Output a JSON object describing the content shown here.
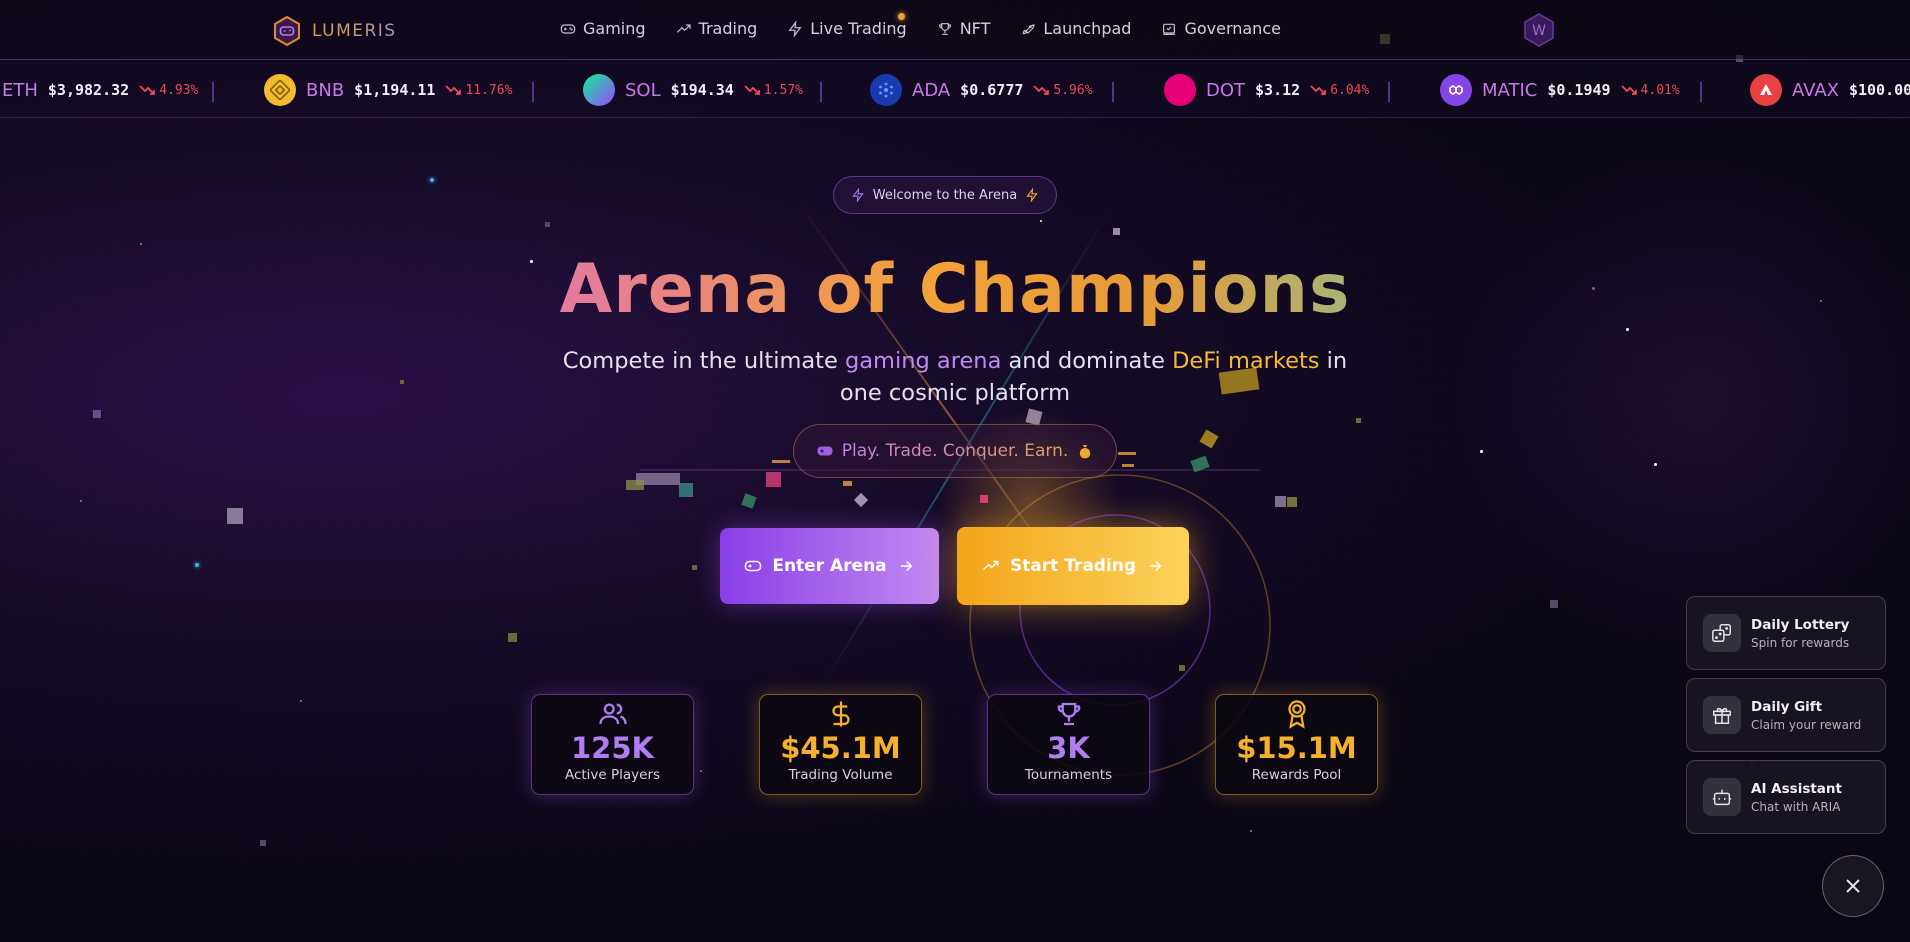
{
  "brand": {
    "name": "LUMERIS"
  },
  "nav": [
    {
      "label": "Gaming",
      "icon": "gamepad-icon"
    },
    {
      "label": "Trading",
      "icon": "trending-up-icon"
    },
    {
      "label": "Live Trading",
      "icon": "zap-icon"
    },
    {
      "label": "NFT",
      "icon": "trophy-icon"
    },
    {
      "label": "Launchpad",
      "icon": "rocket-icon"
    },
    {
      "label": "Governance",
      "icon": "vote-icon"
    }
  ],
  "wallet": {
    "label": "W"
  },
  "ticker": [
    {
      "symbol": "ETH",
      "price": "$3,982.32",
      "change": "4.93%",
      "color": "#627eea"
    },
    {
      "symbol": "BNB",
      "price": "$1,194.11",
      "change": "11.76%",
      "color": "#f3ba2f"
    },
    {
      "symbol": "SOL",
      "price": "$194.34",
      "change": "1.57%",
      "color": "#14f195"
    },
    {
      "symbol": "ADA",
      "price": "$0.6777",
      "change": "5.96%",
      "color": "#0033ad"
    },
    {
      "symbol": "DOT",
      "price": "$3.12",
      "change": "6.04%",
      "color": "#e6007a"
    },
    {
      "symbol": "MATIC",
      "price": "$0.1949",
      "change": "4.01%",
      "color": "#8247e5"
    },
    {
      "symbol": "AVAX",
      "price": "$100.00",
      "change": "",
      "color": "#e84142"
    }
  ],
  "hero": {
    "badge": "Welcome to the Arena",
    "title": "Arena of Champions",
    "subtitle_pre": "Compete in the ultimate ",
    "subtitle_hl1": "gaming arena",
    "subtitle_mid": " and dominate ",
    "subtitle_hl2": "DeFi markets",
    "subtitle_post": " in one cosmic platform",
    "tagline": "Play. Trade. Conquer. Earn.",
    "enter_button": "Enter Arena",
    "trade_button": "Start Trading"
  },
  "stats": [
    {
      "value": "125K",
      "label": "Active Players",
      "icon": "users-icon",
      "accent": "purple"
    },
    {
      "value": "$45.1M",
      "label": "Trading Volume",
      "icon": "dollar-icon",
      "accent": "gold"
    },
    {
      "value": "3K",
      "label": "Tournaments",
      "icon": "trophy-icon",
      "accent": "purple"
    },
    {
      "value": "$15.1M",
      "label": "Rewards Pool",
      "icon": "award-icon",
      "accent": "gold"
    }
  ],
  "side_widgets": [
    {
      "title": "Daily Lottery",
      "subtitle": "Spin for rewards",
      "icon": "dice-icon"
    },
    {
      "title": "Daily Gift",
      "subtitle": "Claim your reward",
      "icon": "gift-icon"
    },
    {
      "title": "AI Assistant",
      "subtitle": "Chat with ARIA",
      "icon": "bot-icon"
    }
  ],
  "colors": {
    "purple": "#b07ef0",
    "gold": "#f6b02c",
    "negative": "#f04a5a",
    "border": "#8c5adc"
  }
}
